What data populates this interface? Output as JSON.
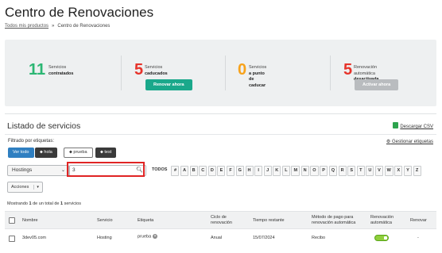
{
  "page": {
    "title": "Centro de Renovaciones",
    "breadcrumb": {
      "link": "Todos mis productos",
      "separator": "»",
      "current": "Centro de Renovaciones"
    }
  },
  "summary": {
    "stats": [
      {
        "count": "11",
        "color": "#2bb673",
        "label1": "Servicios",
        "label2": "contratados",
        "button": ""
      },
      {
        "count": "5",
        "color": "#e6332a",
        "label1": "Servicios",
        "label2": "caducados",
        "button": "Renovar ahora"
      },
      {
        "count": "0",
        "color": "#f7a21b",
        "label1": "Servicios",
        "label2": "a punto de caducar",
        "button": ""
      },
      {
        "count": "5",
        "color": "#e6332a",
        "label1": "Renovación automática",
        "label2": "desactivada",
        "button": "Activar ahora"
      }
    ]
  },
  "list": {
    "title": "Listado de servicios",
    "csv_label": "Descargar CSV",
    "filter_label": "Filtrado por etiquetas:",
    "manage_label": "Gestionar etiquetas",
    "tags": [
      "Ver todo",
      "hola",
      "prueba",
      "test"
    ],
    "select_value": "Hostings",
    "search_value": "3",
    "letters": [
      "TODOS",
      "#",
      "A",
      "B",
      "C",
      "D",
      "E",
      "F",
      "G",
      "H",
      "I",
      "J",
      "K",
      "L",
      "M",
      "N",
      "O",
      "P",
      "Q",
      "R",
      "S",
      "T",
      "U",
      "V",
      "W",
      "X",
      "Y",
      "Z"
    ],
    "actions_label": "Acciones",
    "showing": {
      "prefix": "Mostrando",
      "count": "1",
      "middle": "de un total de",
      "total": "1",
      "suffix": "servicios"
    },
    "columns": {
      "name": "Nombre",
      "service": "Servicio",
      "tag": "Etiqueta",
      "cycle": "Ciclo de renovación",
      "remaining": "Tiempo restante",
      "payment": "Método de pago para renovación automática",
      "auto": "Renovación automática",
      "renew": "Renovar"
    },
    "rows": [
      {
        "name": "3dev05.com",
        "service": "Hosting",
        "tag": "prueba",
        "cycle": "Anual",
        "remaining": "15/07/2024",
        "payment": "Recibo",
        "auto_on": true,
        "renew": "-"
      }
    ]
  }
}
